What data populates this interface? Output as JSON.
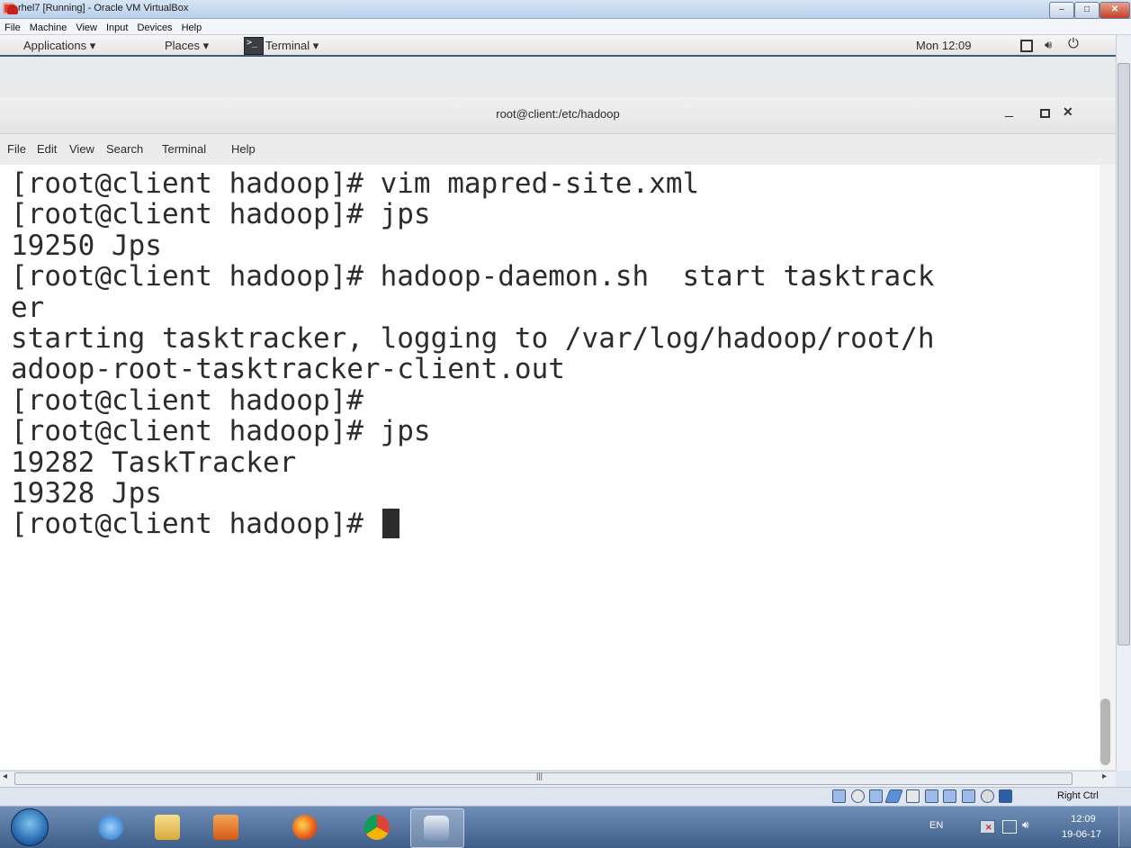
{
  "vbox": {
    "title": "rhel7 [Running] - Oracle VM VirtualBox",
    "menu": [
      "File",
      "Machine",
      "View",
      "Input",
      "Devices",
      "Help"
    ],
    "window_buttons": {
      "minimize": "–",
      "maximize": "□",
      "close": "✕"
    },
    "host_key": "Right Ctrl",
    "status_icons": [
      "hard-disk-icon",
      "optical-drive-icon",
      "usb-icon",
      "shared-folders-icon",
      "display-icon",
      "network-icon",
      "video-capture-icon",
      "cpu-icon",
      "mouse-integration-icon",
      "keyboard-icon"
    ]
  },
  "gnome": {
    "applications": "Applications ▾",
    "places": "Places ▾",
    "terminal_app": "Terminal ▾",
    "clock": "Mon 12:09"
  },
  "terminal": {
    "title": "root@client:/etc/hadoop",
    "menu": [
      "File",
      "Edit",
      "View",
      "Search",
      "Terminal",
      "Help"
    ],
    "lines": [
      "[root@client hadoop]# vim mapred-site.xml",
      "[root@client hadoop]# jps",
      "19250 Jps",
      "[root@client hadoop]# hadoop-daemon.sh  start tasktrack",
      "er",
      "starting tasktracker, logging to /var/log/hadoop/root/h",
      "adoop-root-tasktracker-client.out",
      "[root@client hadoop]#",
      "[root@client hadoop]# jps",
      "19282 TaskTracker",
      "19328 Jps"
    ],
    "prompt": "[root@client hadoop]# "
  },
  "taskbar": {
    "apps": [
      "internet-explorer-icon",
      "file-explorer-icon",
      "media-player-icon",
      "firefox-icon",
      "chrome-icon",
      "virtualbox-icon"
    ],
    "language": "EN",
    "time": "12:09",
    "date": "19-06-17"
  },
  "colors": {
    "terminal_bg": "#ffffff",
    "terminal_fg": "#2c2c2c",
    "taskbar": "#4a6a94"
  }
}
